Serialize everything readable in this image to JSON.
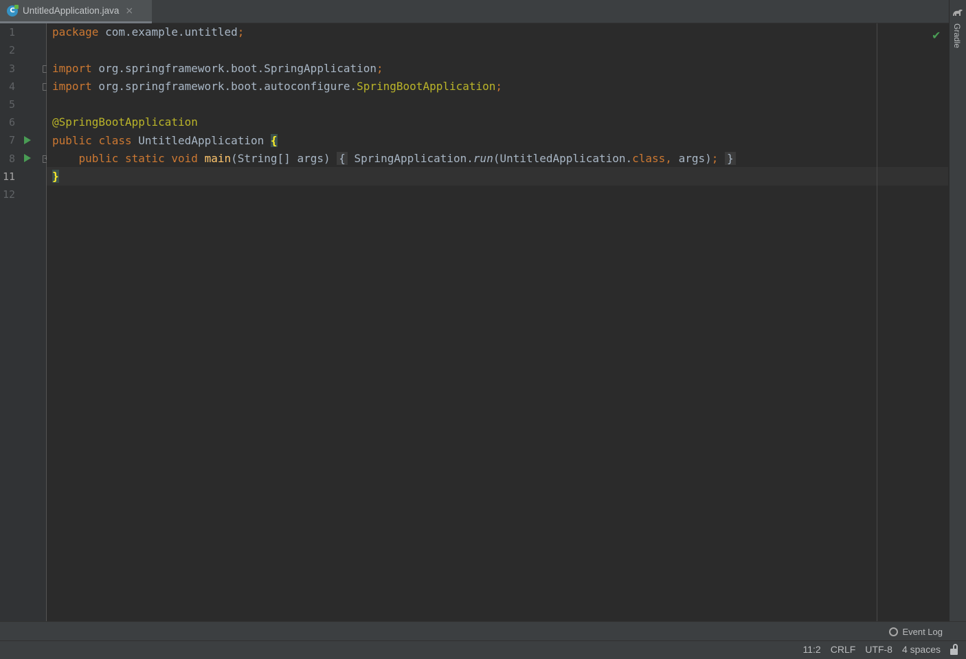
{
  "tab": {
    "file_icon": "C",
    "label": "UntitledApplication.java",
    "close": "×"
  },
  "right_strip": {
    "label": "Gradle"
  },
  "gutter": {
    "line_numbers": [
      "1",
      "2",
      "3",
      "4",
      "5",
      "6",
      "7",
      "8",
      "11",
      "12"
    ]
  },
  "code": {
    "l1": {
      "kw": "package",
      "text": " com.example.untitled",
      "semi": ";"
    },
    "l3": {
      "kw": "import",
      "text": " org.springframework.boot.SpringApplication",
      "semi": ";"
    },
    "l4": {
      "kw": "import",
      "text": " org.springframework.boot.autoconfigure.",
      "cls": "SpringBootApplication",
      "semi": ";"
    },
    "l6": {
      "ann": "@SpringBootApplication"
    },
    "l7": {
      "kw1": "public",
      "kw2": "class",
      "name": "UntitledApplication",
      "brace": "{"
    },
    "l8": {
      "kw1": "public",
      "kw2": "static",
      "kw3": "void",
      "fn": "main",
      "params": "(String[] args)",
      "open": "{",
      "call1": "SpringApplication.",
      "call_it": "run",
      "call2": "(UntitledApplication.",
      "kw_class": "class",
      "comma": ",",
      "call3": " args)",
      "semi": ";",
      "close": "}"
    },
    "l11": {
      "brace": "}"
    }
  },
  "bottom_tools": {
    "event_log": "Event Log"
  },
  "status": {
    "position": "11:2",
    "line_sep": "CRLF",
    "encoding": "UTF-8",
    "indent": "4 spaces"
  },
  "colors": {
    "keyword": "#cc7832",
    "annotation": "#bbb529",
    "function": "#ffc66d",
    "default_text": "#a9b7c6",
    "run_gutter": "#499c54"
  }
}
